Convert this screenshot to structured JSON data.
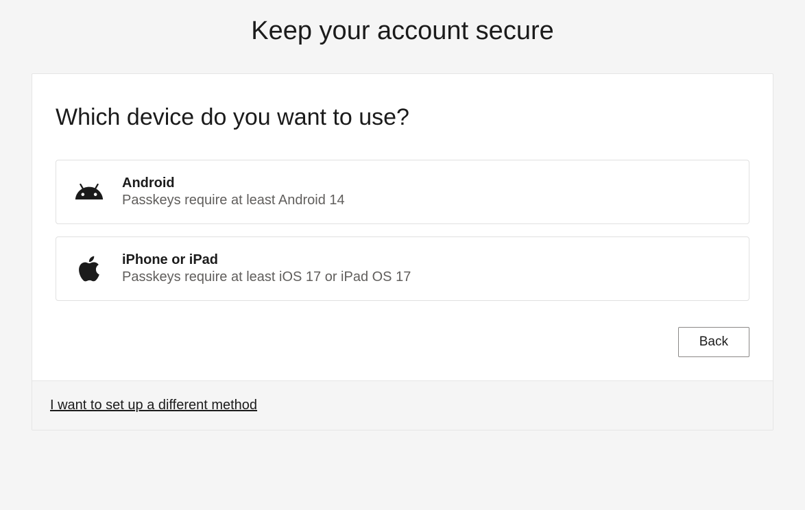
{
  "header": {
    "title": "Keep your account secure"
  },
  "card": {
    "heading": "Which device do you want to use?",
    "devices": [
      {
        "icon": "android-icon",
        "title": "Android",
        "subtitle": "Passkeys require at least Android 14"
      },
      {
        "icon": "apple-icon",
        "title": "iPhone or iPad",
        "subtitle": "Passkeys require at least iOS 17 or iPad OS 17"
      }
    ],
    "back_label": "Back"
  },
  "footer": {
    "different_method_label": "I want to set up a different method"
  }
}
